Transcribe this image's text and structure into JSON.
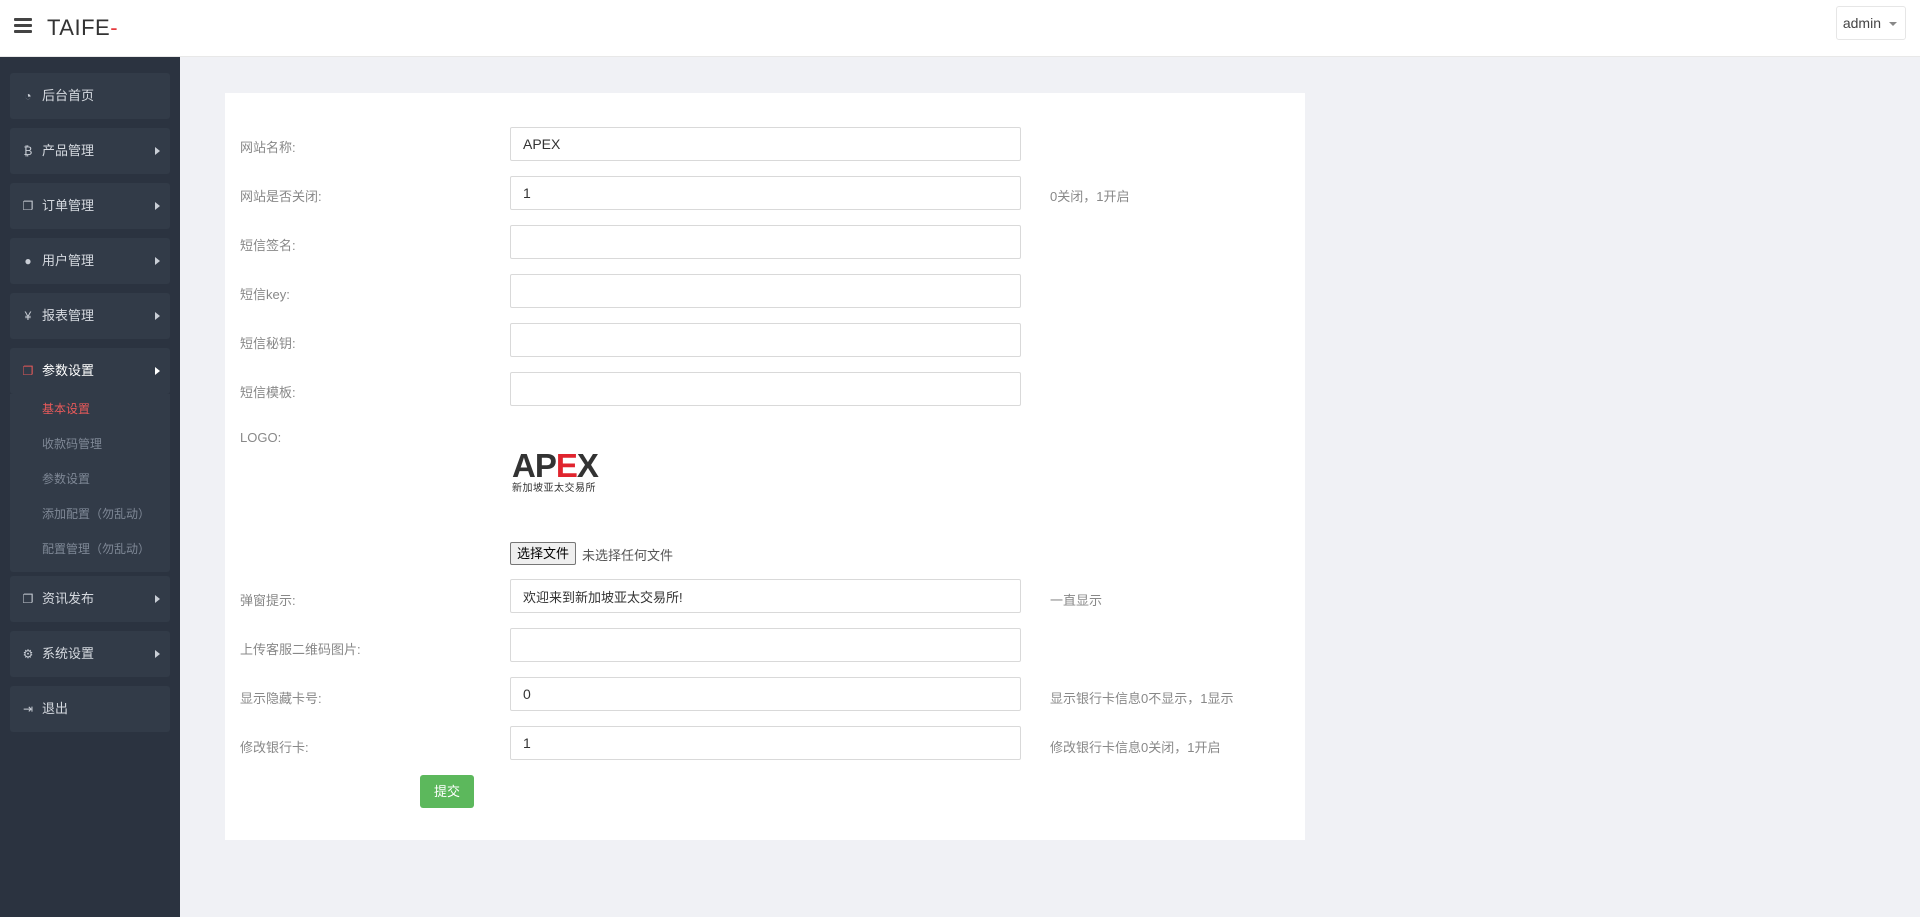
{
  "header": {
    "brand": "TAIFE",
    "brand_suffix": "-",
    "user": "admin"
  },
  "sidebar": {
    "items": [
      {
        "label": "后台首页",
        "icon": "dashboard-icon"
      },
      {
        "label": "产品管理",
        "icon": "bitcoin-icon"
      },
      {
        "label": "订单管理",
        "icon": "copy-icon"
      },
      {
        "label": "用户管理",
        "icon": "user-icon"
      },
      {
        "label": "报表管理",
        "icon": "yen-icon"
      },
      {
        "label": "参数设置",
        "icon": "copy-icon"
      },
      {
        "label": "资讯发布",
        "icon": "copy-icon"
      },
      {
        "label": "系统设置",
        "icon": "gears-icon"
      },
      {
        "label": "退出",
        "icon": "sign-out-icon"
      }
    ],
    "submenu": [
      {
        "label": "基本设置"
      },
      {
        "label": "收款码管理"
      },
      {
        "label": "参数设置"
      },
      {
        "label": "添加配置（勿乱动）"
      },
      {
        "label": "配置管理（勿乱动）"
      }
    ]
  },
  "form": {
    "fields": [
      {
        "label": "网站名称:",
        "value": "APEX",
        "hint": ""
      },
      {
        "label": "网站是否关闭:",
        "value": "1",
        "hint": "0关闭，1开启"
      },
      {
        "label": "短信签名:",
        "value": "",
        "hint": ""
      },
      {
        "label": "短信key:",
        "value": "",
        "hint": ""
      },
      {
        "label": "短信秘钥:",
        "value": "",
        "hint": ""
      },
      {
        "label": "短信模板:",
        "value": "",
        "hint": ""
      }
    ],
    "logo": {
      "label": "LOGO:",
      "logo_prefix": "AP",
      "logo_e": "E",
      "logo_suffix": "X",
      "logo_sub": "新加坡亚太交易所",
      "file_button": "选择文件",
      "file_status": "未选择任何文件"
    },
    "fields2": [
      {
        "label": "弹窗提示:",
        "value": "欢迎来到新加坡亚太交易所!",
        "hint": "一直显示"
      },
      {
        "label": "上传客服二维码图片:",
        "value": "",
        "hint": ""
      },
      {
        "label": "显示隐藏卡号:",
        "value": "0",
        "hint": "显示银行卡信息0不显示，1显示"
      },
      {
        "label": "修改银行卡:",
        "value": "1",
        "hint": "修改银行卡信息0关闭，1开启"
      }
    ],
    "submit": "提交"
  },
  "colors": {
    "sidebar_bg": "#2b3340",
    "accent_red": "#e95a5a",
    "submit_green": "#5cb85c"
  }
}
